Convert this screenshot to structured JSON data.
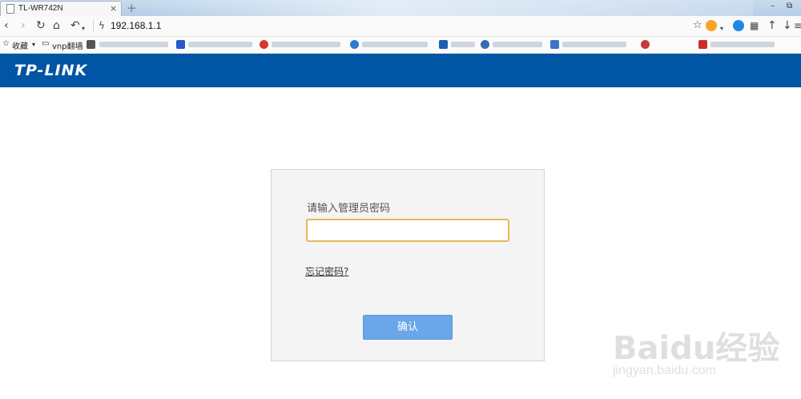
{
  "browser": {
    "tab_title": "TL-WR742N",
    "tab_close": "×",
    "new_tab": "+",
    "url": "192.168.1.1",
    "window_controls": [
      "–",
      "⧉"
    ]
  },
  "nav_icons": [
    "back-icon",
    "forward-icon",
    "reload-icon",
    "home-icon",
    "undo-icon",
    "bolt-icon",
    "star-icon",
    "ext-icon",
    "chat-icon",
    "apps-icon",
    "up-icon",
    "download-icon",
    "menu-icon"
  ],
  "bookmarks": {
    "favorites_label": "收藏",
    "folder_label": "vnp翻墙"
  },
  "brand": {
    "logo_text": "TP-LINK",
    "color": "#0055a4"
  },
  "login": {
    "prompt": "请输入管理员密码",
    "password_value": "",
    "forgot_link": "忘记密码?",
    "confirm_label": "确认"
  },
  "watermark": {
    "logo": "Baidu经验",
    "url": "jingyan.baidu.com"
  }
}
